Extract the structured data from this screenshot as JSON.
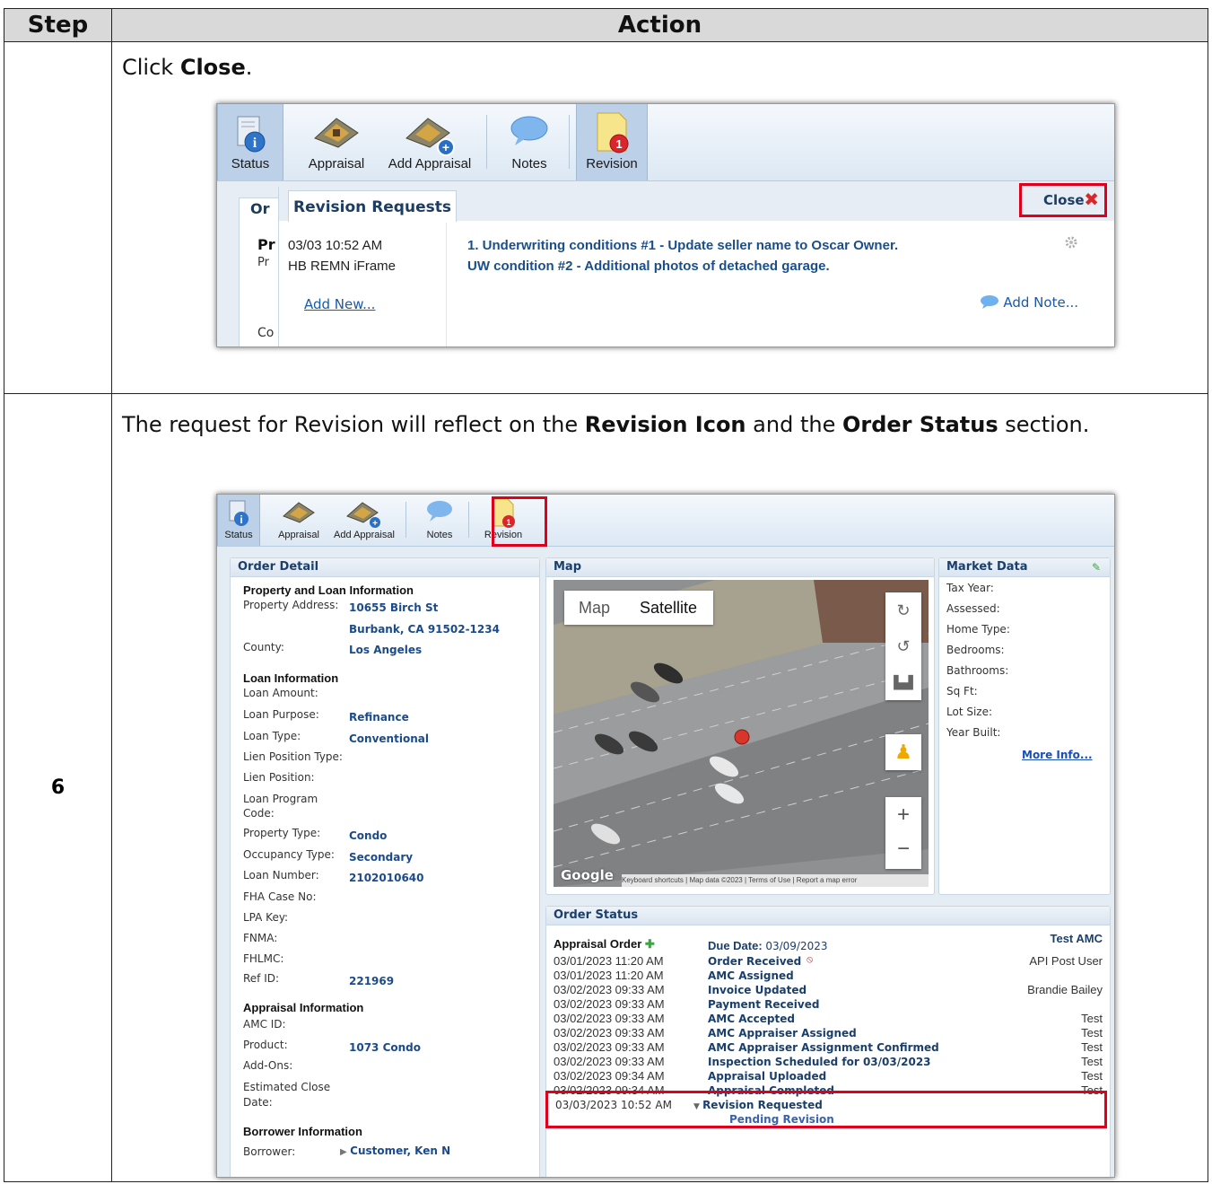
{
  "table": {
    "header": {
      "step": "Step",
      "action": "Action"
    },
    "row1": {
      "instruction_prefix": "Click ",
      "instruction_bold": "Close",
      "instruction_suffix": "."
    },
    "row2": {
      "step": "6",
      "instruction_parts": [
        "The request for Revision will reflect on the ",
        "Revision Icon",
        " and the ",
        "Order Status",
        " section."
      ]
    }
  },
  "toolbar": {
    "status": "Status",
    "appraisal": "Appraisal",
    "add_appraisal": "Add Appraisal",
    "notes": "Notes",
    "revision": "Revision",
    "revision_badge": "1"
  },
  "shot1": {
    "left_tab_label": "Or",
    "left_labels": [
      "Pr",
      "Pr",
      "Co"
    ],
    "revision_tab": "Revision Requests",
    "close_label": "Close",
    "close_icon": "close-x-icon",
    "datetime": "03/03 10:52 AM",
    "source": "HB REMN iFrame",
    "message_line1": "1. Underwriting conditions #1 - Update seller name to Oscar Owner.",
    "message_line2": "UW condition #2 - Additional photos of detached garage.",
    "add_new": "Add New...",
    "add_note": "Add Note..."
  },
  "order_detail": {
    "title": "Order Detail",
    "property_section": "Property and Loan Information",
    "property_address_label": "Property Address:",
    "address_line1": "10655 Birch St",
    "address_line2": "Burbank, CA 91502-1234",
    "county_label": "County:",
    "county": "Los Angeles",
    "loan_section": "Loan Information",
    "loan_amount_label": "Loan Amount:",
    "loan_purpose_label": "Loan Purpose:",
    "loan_purpose": "Refinance",
    "loan_type_label": "Loan Type:",
    "loan_type": "Conventional",
    "lien_position_type_label": "Lien Position Type:",
    "lien_position_label": "Lien Position:",
    "loan_program_label1": "Loan Program",
    "loan_program_label2": "Code:",
    "property_type_label": "Property Type:",
    "property_type": "Condo",
    "occupancy_type_label": "Occupancy Type:",
    "occupancy_type": "Secondary",
    "loan_number_label": "Loan Number:",
    "loan_number": "2102010640",
    "fha_label": "FHA Case No:",
    "lpa_label": "LPA Key:",
    "fnma_label": "FNMA:",
    "fhlmc_label": "FHLMC:",
    "ref_id_label": "Ref ID:",
    "ref_id": "221969",
    "appraisal_section": "Appraisal Information",
    "amc_id_label": "AMC ID:",
    "product_label": "Product:",
    "product": "1073 Condo",
    "addons_label": "Add-Ons:",
    "est_close_label1": "Estimated Close",
    "est_close_label2": "Date:",
    "borrower_section": "Borrower Information",
    "borrower_label": "Borrower:",
    "borrower": "Customer, Ken N"
  },
  "map": {
    "title": "Map",
    "map_btn": "Map",
    "satellite_btn": "Satellite",
    "google": "Google",
    "attribution": [
      "Keyboard shortcuts",
      "Map data ©2023",
      "Terms of Use",
      "Report a map error"
    ]
  },
  "market_data": {
    "title": "Market Data",
    "labels": [
      "Tax Year:",
      "Assessed:",
      "Home Type:",
      "Bedrooms:",
      "Bathrooms:",
      "Sq Ft:",
      "Lot Size:",
      "Year Built:"
    ],
    "more_info": "More Info..."
  },
  "order_status": {
    "title": "Order Status",
    "appraisal_order": "Appraisal Order",
    "due_date_label": "Due Date:",
    "due_date": "03/09/2023",
    "vendor": "Test AMC",
    "events": [
      {
        "time": "03/01/2023 11:20 AM",
        "event": "Order Received",
        "user": "API Post User"
      },
      {
        "time": "03/01/2023 11:20 AM",
        "event": "AMC Assigned",
        "user": ""
      },
      {
        "time": "03/02/2023 09:33 AM",
        "event": "Invoice Updated",
        "user": "Brandie Bailey"
      },
      {
        "time": "03/02/2023 09:33 AM",
        "event": "Payment Received",
        "user": ""
      },
      {
        "time": "03/02/2023 09:33 AM",
        "event": "AMC Accepted",
        "user": "Test"
      },
      {
        "time": "03/02/2023 09:33 AM",
        "event": "AMC Appraiser Assigned",
        "user": "Test"
      },
      {
        "time": "03/02/2023 09:33 AM",
        "event": "AMC Appraiser Assignment Confirmed",
        "user": "Test"
      },
      {
        "time": "03/02/2023 09:33 AM",
        "event": "Inspection Scheduled for 03/03/2023",
        "user": "Test"
      },
      {
        "time": "03/02/2023 09:34 AM",
        "event": "Appraisal Uploaded",
        "user": "Test"
      },
      {
        "time": "03/02/2023 09:34 AM",
        "event": "Appraisal Completed",
        "user": "Test"
      }
    ],
    "revision_time": "03/03/2023 10:52 AM",
    "revision_event": "Revision Requested",
    "revision_sub": "Pending Revision"
  },
  "colors": {
    "highlight": "#e0001b",
    "link": "#1a4f8b"
  }
}
